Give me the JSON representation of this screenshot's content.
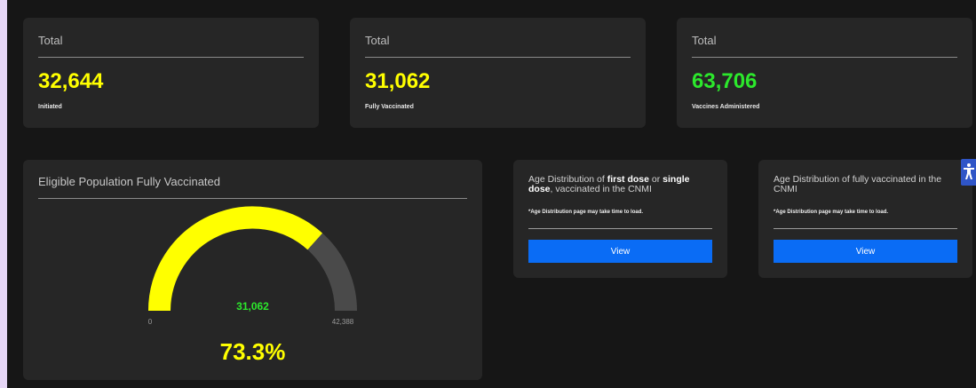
{
  "cards": [
    {
      "label": "Total",
      "value": "32,644",
      "sublabel": "Initiated",
      "value_color": "#ffff00"
    },
    {
      "label": "Total",
      "value": "31,062",
      "sublabel": "Fully Vaccinated",
      "value_color": "#ffff00"
    },
    {
      "label": "Total",
      "value": "63,706",
      "sublabel": "Vaccines Administered",
      "value_color": "#2ce82c"
    }
  ],
  "gauge": {
    "title": "Eligible Population Fully Vaccinated",
    "value": "31,062",
    "min_label": "0",
    "max_label": "42,388",
    "percent": "73.3%",
    "fraction": 0.733,
    "fill_color": "#ffff00",
    "track_color": "#4a4a4a"
  },
  "age_cards": [
    {
      "title_parts": [
        "Age Distribution of ",
        "first dose",
        " or ",
        "single dose",
        ", vaccinated in the CNMI"
      ],
      "note": "*Age Distribution page may take time to load.",
      "button": "View"
    },
    {
      "title": "Age Distribution of fully vaccinated in the CNMI",
      "note": "*Age Distribution page may take time to load.",
      "button": "View"
    }
  ],
  "accessibility_icon": "accessibility-icon",
  "accent_button_color": "#0a6cf5"
}
